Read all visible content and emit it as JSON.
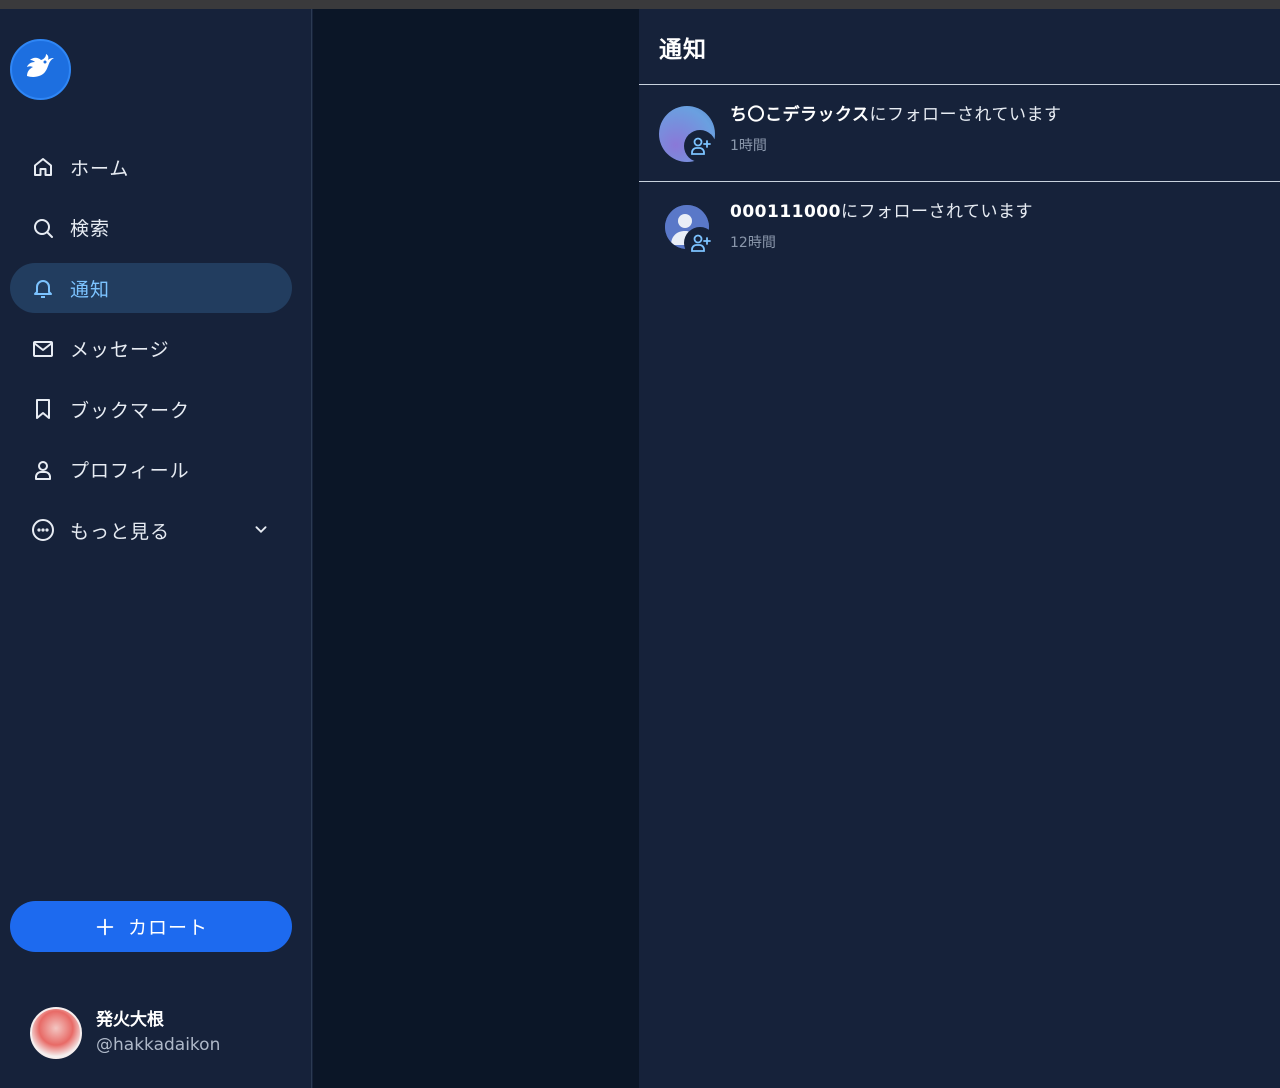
{
  "sidebar": {
    "items": [
      {
        "label": "ホーム",
        "icon": "home-icon"
      },
      {
        "label": "検索",
        "icon": "search-icon"
      },
      {
        "label": "通知",
        "icon": "bell-icon",
        "active": true
      },
      {
        "label": "メッセージ",
        "icon": "mail-icon"
      },
      {
        "label": "ブックマーク",
        "icon": "bookmark-icon"
      },
      {
        "label": "プロフィール",
        "icon": "user-icon"
      },
      {
        "label": "もっと見る",
        "icon": "more-circle-icon"
      }
    ],
    "post_button_label": "カロート",
    "profile": {
      "name": "発火大根",
      "handle": "@hakkadaikon"
    }
  },
  "main": {
    "title": "通知",
    "notifications": [
      {
        "user": "ち〇こデラックス",
        "action": "にフォローされています",
        "time": "1時間"
      },
      {
        "user": "000111000",
        "action": "にフォローされています",
        "time": "12時間"
      }
    ]
  },
  "colors": {
    "accent": "#1d6aef",
    "active_bg": "#223d5f",
    "active_text": "#7cc3ff",
    "background": "#16223a"
  }
}
